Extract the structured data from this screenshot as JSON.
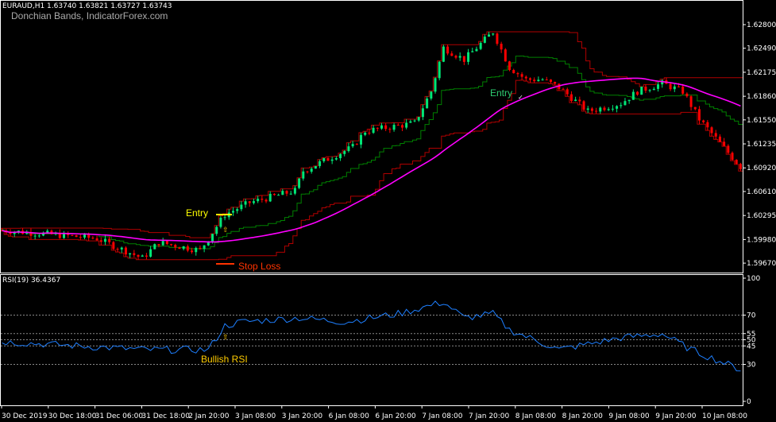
{
  "header": {
    "symbol_line": "EURAUD,H1  1.63740 1.63821 1.63727 1.63743",
    "indicator_title": "Donchian Bands, IndicatorForex.com"
  },
  "rsi_header": "RSI(19) 36.4367",
  "annotations": {
    "entry_long": "Entry",
    "stop_loss": "Stop Loss",
    "entry_short": "Entry",
    "bullish_rsi": "Bullish RSI"
  },
  "colors": {
    "bull": "#00e676",
    "bear": "#ff0000",
    "ma": "#ff00ff",
    "mid": "#008000",
    "band": "#b00000",
    "rsi": "#1e7fff",
    "entry": "#ffff00",
    "stop": "#ff3300",
    "entry2": "#2ecc71"
  },
  "chart_data": [
    {
      "type": "candlestick",
      "title": "EURAUD,H1",
      "ylim": [
        1.5956,
        1.6302
      ],
      "yticks": [
        "1.62800",
        "1.62490",
        "1.62175",
        "1.61860",
        "1.61550",
        "1.61235",
        "1.60920",
        "1.60610",
        "1.60295",
        "1.59980",
        "1.59670"
      ],
      "xticks": [
        "30 Dec 2019",
        "30 Dec 18:00",
        "31 Dec 06:00",
        "31 Dec 18:00",
        "2 Jan 20:00",
        "3 Jan 08:00",
        "3 Jan 20:00",
        "6 Jan 08:00",
        "6 Jan 20:00",
        "7 Jan 08:00",
        "7 Jan 20:00",
        "8 Jan 08:00",
        "8 Jan 20:00",
        "9 Jan 08:00",
        "9 Jan 20:00",
        "10 Jan 08:00"
      ],
      "bars": 180,
      "price_path": [
        [
          0,
          1.60099
        ],
        [
          12,
          1.60047
        ],
        [
          23,
          1.59994
        ],
        [
          34,
          1.59734
        ],
        [
          38,
          1.59942
        ],
        [
          48,
          1.59838
        ],
        [
          50,
          1.59994
        ],
        [
          54,
          1.60307
        ],
        [
          60,
          1.60464
        ],
        [
          71,
          1.6062
        ],
        [
          73,
          1.60881
        ],
        [
          85,
          1.61194
        ],
        [
          88,
          1.61402
        ],
        [
          100,
          1.61507
        ],
        [
          104,
          1.61924
        ],
        [
          107,
          1.62498
        ],
        [
          112,
          1.62341
        ],
        [
          119,
          1.62706
        ],
        [
          123,
          1.62237
        ],
        [
          127,
          1.6208
        ],
        [
          131,
          1.6208
        ],
        [
          135,
          1.61976
        ],
        [
          142,
          1.61663
        ],
        [
          150,
          1.61767
        ],
        [
          154,
          1.61924
        ],
        [
          160,
          1.62028
        ],
        [
          165,
          1.61924
        ],
        [
          169,
          1.61559
        ],
        [
          179,
          1.60933
        ]
      ],
      "series": [
        "Donchian upper",
        "Donchian middle",
        "Donchian lower",
        "Moving average"
      ]
    },
    {
      "type": "line",
      "title": "RSI(19) 36.4367",
      "ylim": [
        0,
        100
      ],
      "yticks": [
        100,
        70,
        55,
        50,
        45,
        30,
        0
      ],
      "levels": [
        70,
        55,
        50,
        45,
        30
      ],
      "rsi_path": [
        [
          0,
          48.4
        ],
        [
          35,
          41.9
        ],
        [
          50,
          41.9
        ],
        [
          54,
          61.3
        ],
        [
          58,
          64.5
        ],
        [
          72,
          67.7
        ],
        [
          83,
          64.5
        ],
        [
          96,
          71
        ],
        [
          107,
          80.6
        ],
        [
          112,
          67.7
        ],
        [
          119,
          71
        ],
        [
          123,
          58
        ],
        [
          135,
          42
        ],
        [
          150,
          51.6
        ],
        [
          160,
          54.8
        ],
        [
          167,
          42
        ],
        [
          179,
          25.8
        ]
      ]
    }
  ]
}
